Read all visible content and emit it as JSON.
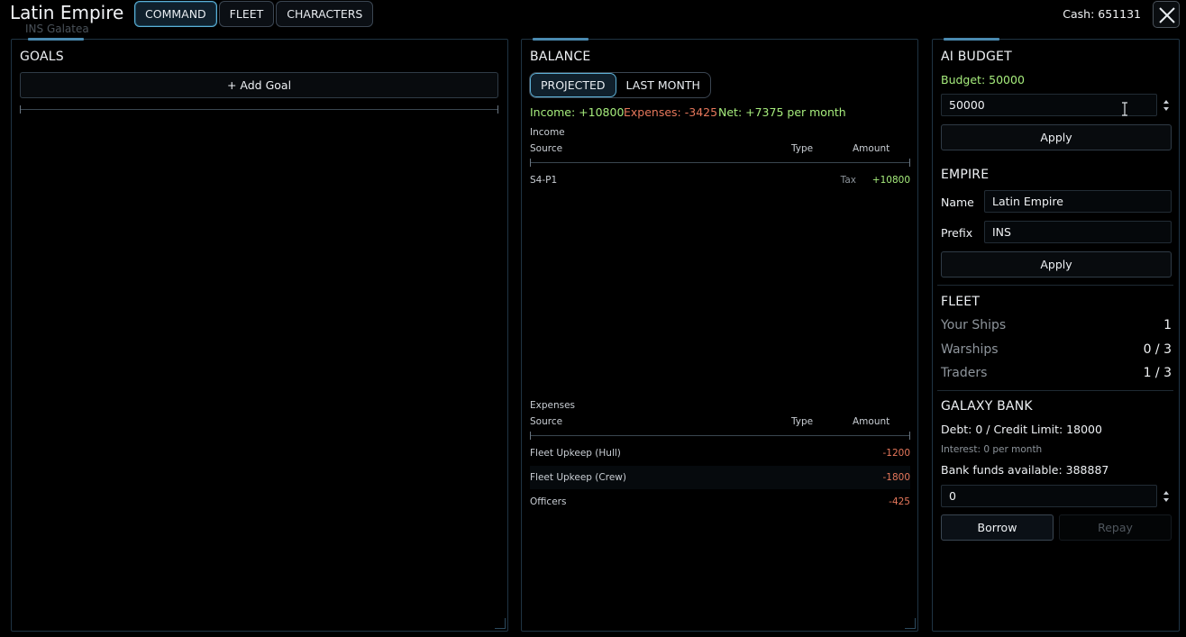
{
  "window": {
    "title": "Latin Empire",
    "ghost_label": "INS Galatea",
    "cash": "Cash: 651131"
  },
  "tabs": [
    {
      "label": "COMMAND",
      "active": true
    },
    {
      "label": "FLEET",
      "active": false
    },
    {
      "label": "CHARACTERS",
      "active": false
    }
  ],
  "goals": {
    "title": "GOALS",
    "add_label": "+ Add Goal"
  },
  "balance": {
    "title": "BALANCE",
    "toggle": [
      "PROJECTED",
      "LAST MONTH"
    ],
    "income_total": "Income: +10800",
    "expenses_total": "Expenses: -3425",
    "net": "Net: +7375 per month",
    "income_section": "Income",
    "expenses_section": "Expenses",
    "columns": {
      "source": "Source",
      "type": "Type",
      "amount": "Amount"
    },
    "income_rows": [
      {
        "source": "S4-P1",
        "type": "Tax",
        "amount": "+10800"
      }
    ],
    "expense_rows": [
      {
        "source": "Fleet Upkeep (Hull)",
        "type": "",
        "amount": "-1200"
      },
      {
        "source": "Fleet Upkeep (Crew)",
        "type": "",
        "amount": "-1800"
      },
      {
        "source": "Officers",
        "type": "",
        "amount": "-425"
      }
    ]
  },
  "ai_budget": {
    "title": "AI BUDGET",
    "budget_label": "Budget: 50000",
    "input_value": "50000",
    "apply_label": "Apply"
  },
  "empire": {
    "title": "EMPIRE",
    "name_label": "Name",
    "name_value": "Latin Empire",
    "prefix_label": "Prefix",
    "prefix_value": "INS",
    "apply_label": "Apply"
  },
  "fleet": {
    "title": "FLEET",
    "rows": [
      {
        "label": "Your Ships",
        "value": "1"
      },
      {
        "label": "Warships",
        "value": "0 / 3"
      },
      {
        "label": "Traders",
        "value": "1 / 3"
      }
    ]
  },
  "bank": {
    "title": "GALAXY BANK",
    "debt": "Debt: 0 / Credit Limit: 18000",
    "interest": "Interest: 0 per month",
    "funds": "Bank funds available: 388887",
    "input_value": "0",
    "borrow_label": "Borrow",
    "repay_label": "Repay"
  },
  "colors": {
    "accent": "#5db0d6",
    "positive": "#a6ec7c",
    "negative": "#e6775b",
    "panel_border": "#1f3444"
  }
}
